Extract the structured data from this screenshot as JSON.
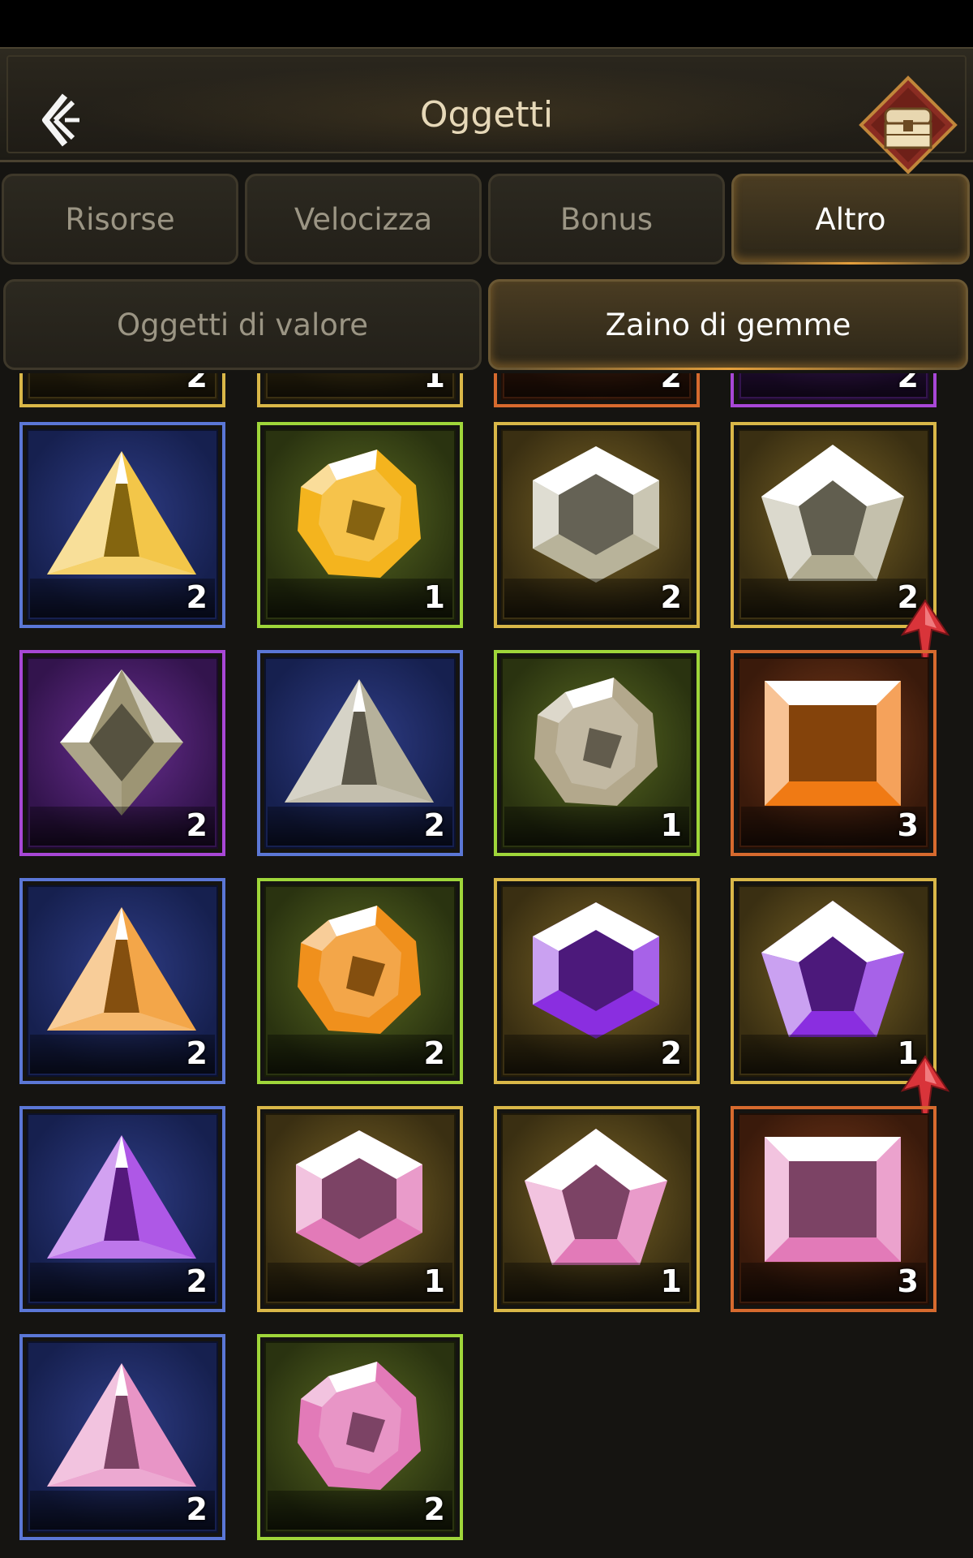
{
  "header": {
    "title": "Oggetti",
    "back_icon": "back-arrow-icon",
    "chest_icon": "treasure-chest-icon"
  },
  "tabs": [
    {
      "label": "Risorse",
      "active": false
    },
    {
      "label": "Velocizza",
      "active": false
    },
    {
      "label": "Bonus",
      "active": false
    },
    {
      "label": "Altro",
      "active": true
    }
  ],
  "subtabs": [
    {
      "label": "Oggetti di valore",
      "active": false
    },
    {
      "label": "Zaino di gemme",
      "active": true
    }
  ],
  "colors": {
    "blue": "#5b77d6",
    "green": "#9fd63a",
    "gold": "#d9b748",
    "purple": "#a847d6",
    "orange": "#d66a2e",
    "accent": "#e6a03c"
  },
  "gems_partial_row": [
    {
      "rarity": "gold",
      "qty": "2"
    },
    {
      "rarity": "gold",
      "qty": "1"
    },
    {
      "rarity": "orange",
      "qty": "2"
    },
    {
      "rarity": "purple",
      "qty": "2"
    }
  ],
  "gems": [
    {
      "rarity": "blue",
      "shape": "triangle",
      "color": "#f0b81c",
      "qty": "2",
      "upgrade": false
    },
    {
      "rarity": "green",
      "shape": "rough",
      "color": "#f4b41e",
      "qty": "1",
      "upgrade": false
    },
    {
      "rarity": "gold",
      "shape": "hexagon",
      "color": "#b8b39a",
      "qty": "2",
      "upgrade": false
    },
    {
      "rarity": "gold",
      "shape": "pentagon",
      "color": "#b0ab90",
      "qty": "2",
      "upgrade": true
    },
    {
      "rarity": "purple",
      "shape": "diamond",
      "color": "#9d9574",
      "qty": "2",
      "upgrade": false
    },
    {
      "rarity": "blue",
      "shape": "triangle",
      "color": "#a49d82",
      "qty": "2",
      "upgrade": false
    },
    {
      "rarity": "green",
      "shape": "rough",
      "color": "#b3a88c",
      "qty": "1",
      "upgrade": false
    },
    {
      "rarity": "orange",
      "shape": "square",
      "color": "#f07a14",
      "qty": "3",
      "upgrade": false
    },
    {
      "rarity": "blue",
      "shape": "triangle",
      "color": "#f0901c",
      "qty": "2",
      "upgrade": false
    },
    {
      "rarity": "green",
      "shape": "rough",
      "color": "#f0901c",
      "qty": "2",
      "upgrade": false
    },
    {
      "rarity": "gold",
      "shape": "hexagon",
      "color": "#8a2ee0",
      "qty": "2",
      "upgrade": false
    },
    {
      "rarity": "gold",
      "shape": "pentagon",
      "color": "#8a2ee0",
      "qty": "1",
      "upgrade": true
    },
    {
      "rarity": "blue",
      "shape": "triangle",
      "color": "#9a2ee0",
      "qty": "2",
      "upgrade": false
    },
    {
      "rarity": "gold",
      "shape": "hexagon",
      "color": "#e27ab8",
      "qty": "1",
      "upgrade": false
    },
    {
      "rarity": "gold",
      "shape": "pentagon",
      "color": "#e27ab8",
      "qty": "1",
      "upgrade": false
    },
    {
      "rarity": "orange",
      "shape": "square",
      "color": "#e27ab8",
      "qty": "3",
      "upgrade": false
    },
    {
      "rarity": "blue",
      "shape": "triangle",
      "color": "#e27ab8",
      "qty": "2",
      "upgrade": false
    },
    {
      "rarity": "green",
      "shape": "rough",
      "color": "#e27ab8",
      "qty": "2",
      "upgrade": false
    }
  ]
}
